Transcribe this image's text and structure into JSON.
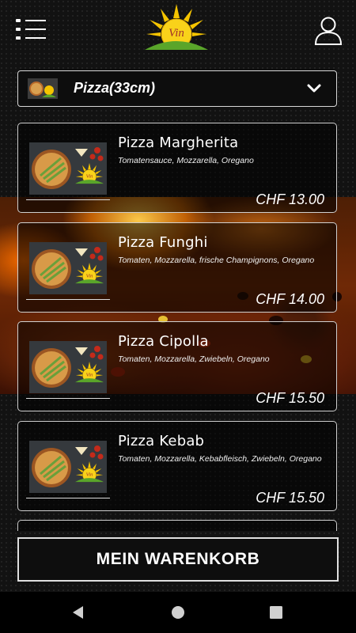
{
  "header": {
    "menu_icon": "menu-icon",
    "logo_text": "Vin",
    "user_icon": "user-icon"
  },
  "category": {
    "selected": "Pizza(33cm)",
    "icon": "chevron-down-icon"
  },
  "products": [
    {
      "name": "Pizza Margherita",
      "description": "Tomatensauce, Mozzarella, Oregano",
      "price": "CHF 13.00"
    },
    {
      "name": "Pizza Funghi",
      "description": "Tomaten, Mozzarella, frische Champignons, Oregano",
      "price": "CHF 14.00"
    },
    {
      "name": "Pizza Cipolla",
      "description": "Tomaten, Mozzarella, Zwiebeln, Oregano",
      "price": "CHF 15.50"
    },
    {
      "name": "Pizza Kebab",
      "description": "Tomaten, Mozzarella, Kebabfleisch, Zwiebeln, Oregano",
      "price": "CHF 15.50"
    }
  ],
  "cart": {
    "label": "MEIN WARENKORB"
  },
  "colors": {
    "background": "#121212",
    "border": "#d8d8d8",
    "logo_sun": "#f5c400",
    "logo_hill": "#5aa52a"
  }
}
